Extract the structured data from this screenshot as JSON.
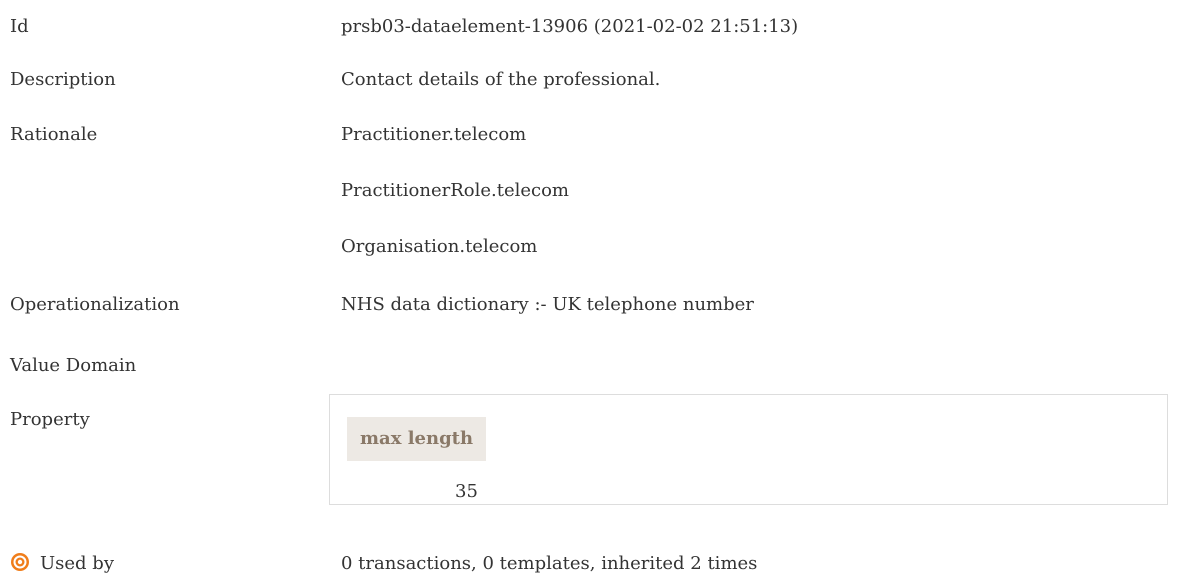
{
  "rows": {
    "id": {
      "label": "Id",
      "value": "prsb03-dataelement-13906 (2021-02-02 21:51:13)"
    },
    "description": {
      "label": "Description",
      "value": "Contact details of the professional."
    },
    "rationale": {
      "label": "Rationale",
      "lines": [
        "Practitioner.telecom",
        "PractitionerRole.telecom",
        "Organisation.telecom"
      ]
    },
    "operationalization": {
      "label": "Operationalization",
      "value": "NHS data dictionary :- UK telephone number"
    },
    "value_domain": {
      "label": "Value Domain"
    },
    "property": {
      "label": "Property",
      "header": "max length",
      "value": "35"
    },
    "used_by": {
      "label": "Used by",
      "icon": "target-icon",
      "value": "0 transactions, 0 templates, inherited 2 times"
    }
  },
  "colors": {
    "text": "#333333",
    "property_header_bg": "#ede9e4",
    "property_header_text": "#8a7968",
    "icon_accent": "#f07d1a"
  }
}
